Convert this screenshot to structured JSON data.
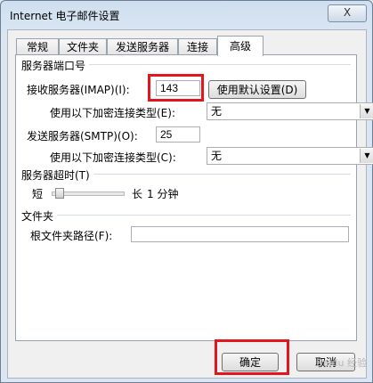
{
  "window": {
    "title": "Internet 电子邮件设置",
    "close_label": "X"
  },
  "tabs": [
    {
      "label": "常规"
    },
    {
      "label": "文件夹"
    },
    {
      "label": "发送服务器"
    },
    {
      "label": "连接"
    },
    {
      "label": "高级"
    }
  ],
  "server_ports": {
    "group_title": "服务器端口号",
    "incoming_label": "接收服务器(IMAP)(I):",
    "incoming_value": "143",
    "default_button": "使用默认设置(D)",
    "encrypt_in_label": "使用以下加密连接类型(E):",
    "encrypt_in_value": "无",
    "outgoing_label": "发送服务器(SMTP)(O):",
    "outgoing_value": "25",
    "encrypt_out_label": "使用以下加密连接类型(C):",
    "encrypt_out_value": "无"
  },
  "timeout": {
    "group_title": "服务器超时(T)",
    "short_label": "短",
    "long_label": "长",
    "value_text": "1 分钟",
    "level": 0.05
  },
  "folders": {
    "group_title": "文件夹",
    "root_label": "根文件夹路径(F):",
    "root_value": ""
  },
  "footer": {
    "ok_button": "确定",
    "cancel_button": "取消"
  },
  "watermark": "Baidu 经验"
}
